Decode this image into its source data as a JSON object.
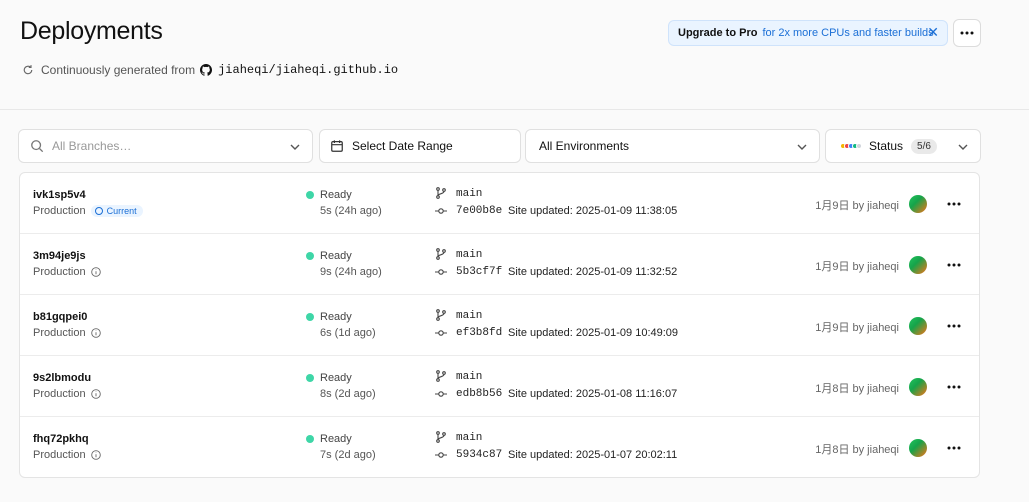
{
  "header": {
    "title": "Deployments",
    "subtitle_prefix": "Continuously generated from",
    "repo": "jiaheqi/jiaheqi.github.io",
    "upgrade_strong": "Upgrade to Pro",
    "upgrade_rest": "for 2x more CPUs and faster builds"
  },
  "filters": {
    "branches_placeholder": "All Branches…",
    "date_range": "Select Date Range",
    "environments": "All Environments",
    "status_label": "Status",
    "status_count": "5/6",
    "status_dot_colors": [
      "#f5b400",
      "#ef4444",
      "#3b82f6",
      "#10b981",
      "#d1d5db"
    ]
  },
  "deployments": [
    {
      "id": "ivk1sp5v4",
      "env": "Production",
      "current": "Current",
      "status": "Ready",
      "duration": "5s (24h ago)",
      "branch": "main",
      "commit": "7e00b8e",
      "message": "Site updated: 2025-01-09 11:38:05",
      "meta": "1月9日 by jiaheqi"
    },
    {
      "id": "3m94je9js",
      "env": "Production",
      "current": "",
      "status": "Ready",
      "duration": "9s (24h ago)",
      "branch": "main",
      "commit": "5b3cf7f",
      "message": "Site updated: 2025-01-09 11:32:52",
      "meta": "1月9日 by jiaheqi"
    },
    {
      "id": "b81gqpei0",
      "env": "Production",
      "current": "",
      "status": "Ready",
      "duration": "6s (1d ago)",
      "branch": "main",
      "commit": "ef3b8fd",
      "message": "Site updated: 2025-01-09 10:49:09",
      "meta": "1月9日 by jiaheqi"
    },
    {
      "id": "9s2lbmodu",
      "env": "Production",
      "current": "",
      "status": "Ready",
      "duration": "8s (2d ago)",
      "branch": "main",
      "commit": "edb8b56",
      "message": "Site updated: 2025-01-08 11:16:07",
      "meta": "1月8日 by jiaheqi"
    },
    {
      "id": "fhq72pkhq",
      "env": "Production",
      "current": "",
      "status": "Ready",
      "duration": "7s (2d ago)",
      "branch": "main",
      "commit": "5934c87",
      "message": "Site updated: 2025-01-07 20:02:11",
      "meta": "1月8日 by jiaheqi"
    }
  ],
  "colors": {
    "ready": "#3ed6a7",
    "accent": "#1b6fd6"
  },
  "icons": {
    "refresh": "refresh-icon",
    "github": "github-icon",
    "search": "search-icon",
    "calendar": "calendar-icon",
    "chevron": "chevron-down-icon",
    "branch": "git-branch-icon",
    "commit": "git-commit-icon",
    "info": "info-icon",
    "more": "more-horizontal-icon",
    "close": "close-icon"
  }
}
